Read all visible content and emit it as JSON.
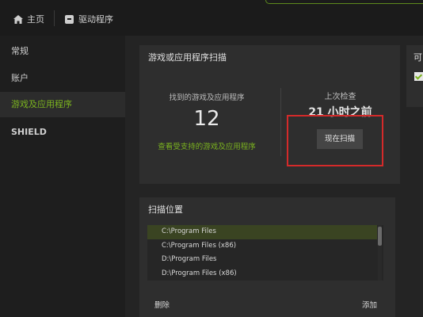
{
  "nav": {
    "home_label": "主页",
    "drivers_label": "驱动程序"
  },
  "sidebar": {
    "items": [
      {
        "label": "常规"
      },
      {
        "label": "账户"
      },
      {
        "label": "游戏及应用程序"
      },
      {
        "label": "SHIELD"
      }
    ]
  },
  "scan_panel": {
    "title": "游戏或应用程序扫描",
    "found_label": "找到的游戏及应用程序",
    "found_count": "12",
    "supported_link": "查看受支持的游戏及应用程序",
    "last_scan_label": "上次检查",
    "last_scan_time": "21 小时之前",
    "scan_now_label": "现在扫描"
  },
  "locations_panel": {
    "title": "扫描位置",
    "paths": [
      "C:\\Program Files",
      "C:\\Program Files (x86)",
      "D:\\Program Files",
      "D:\\Program Files (x86)"
    ],
    "remove_label": "删除",
    "add_label": "添加"
  },
  "right_panel": {
    "title": "可"
  },
  "colors": {
    "accent": "#7bb31f",
    "highlight": "#d42a2a",
    "background": "#242424"
  }
}
